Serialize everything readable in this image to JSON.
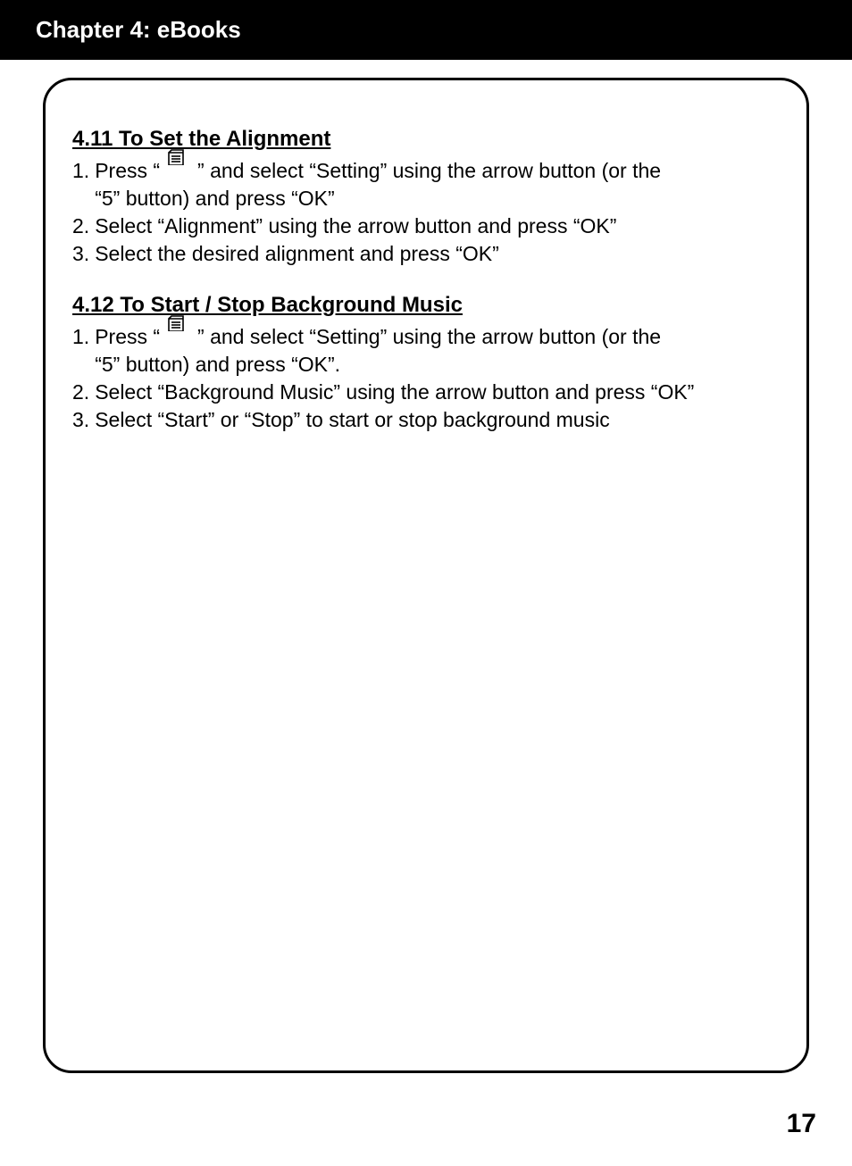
{
  "header": {
    "title": "Chapter 4: eBooks"
  },
  "sections": [
    {
      "heading": "4.11 To Set the Alignment",
      "steps": [
        {
          "num": "1.",
          "has_icon": true,
          "line1_before": "Press “",
          "line1_after": "” and select “Setting” using the arrow button (or the",
          "line2": "“5” button) and press “OK”"
        },
        {
          "num": "2.",
          "text": "Select “Alignment” using the arrow button and press “OK”"
        },
        {
          "num": "3.",
          "text": "Select the desired alignment and press “OK”"
        }
      ]
    },
    {
      "heading": "4.12 To Start / Stop Background Music",
      "steps": [
        {
          "num": "1.",
          "has_icon": true,
          "line1_before": "Press “",
          "line1_after": "” and select “Setting” using the arrow button (or the",
          "line2": "“5” button) and press “OK”."
        },
        {
          "num": "2.",
          "text": "Select “Background Music” using the arrow button and press “OK”"
        },
        {
          "num": "3.",
          "text": "Select “Start” or “Stop” to start or stop background music"
        }
      ]
    }
  ],
  "page_number": "17"
}
